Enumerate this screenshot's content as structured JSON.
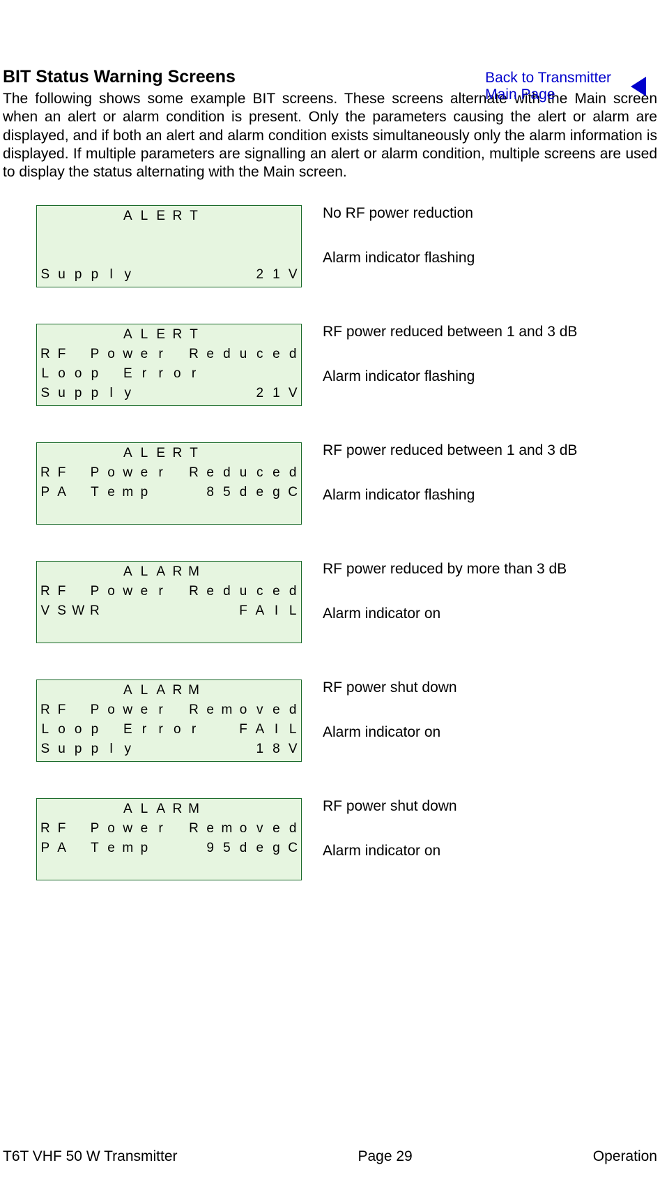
{
  "topLink": {
    "line1": "Back to Transmitter",
    "line2": "Main Page"
  },
  "heading": "BIT Status Warning Screens",
  "intro": "The following shows some example BIT screens. These screens alternate with the Main screen when an alert or alarm condition is present. Only the parameters causing the alert or alarm are displayed, and if both an alert and alarm condition exists simultaneously only the alarm information is displayed. If multiple parameters are signalling an alert or alarm condition, multiple screens are used to display the status alternating with the Main screen.",
  "screens": [
    {
      "lines": [
        "     ALERT      ",
        "                ",
        "                ",
        "Supply       21V"
      ],
      "note1": "No RF power reduction",
      "note2": "Alarm indicator flashing"
    },
    {
      "lines": [
        "     ALERT      ",
        "RF Power Reduced",
        "Loop Error      ",
        "Supply       21V"
      ],
      "note1": "RF power reduced between 1 and 3 dB",
      "note2": "Alarm indicator flashing"
    },
    {
      "lines": [
        "     ALERT      ",
        "RF Power Reduced",
        "PA Temp   85degC",
        "                "
      ],
      "note1": "RF power reduced between 1 and 3 dB",
      "note2": "Alarm indicator flashing"
    },
    {
      "lines": [
        "     ALARM      ",
        "RF Power Reduced",
        "VSWR        FAIL",
        "                "
      ],
      "note1": "RF power reduced by more than 3 dB",
      "note2": "Alarm indicator on"
    },
    {
      "lines": [
        "     ALARM      ",
        "RF Power Removed",
        "Loop Error  FAIL",
        "Supply       18V"
      ],
      "note1": "RF power shut down",
      "note2": "Alarm indicator on"
    },
    {
      "lines": [
        "     ALARM      ",
        "RF Power Removed",
        "PA Temp   95degC",
        "                "
      ],
      "note1": "RF power shut down",
      "note2": "Alarm indicator on"
    }
  ],
  "footer": {
    "left": "T6T VHF 50 W Transmitter",
    "center": "Page 29",
    "right": "Operation"
  }
}
